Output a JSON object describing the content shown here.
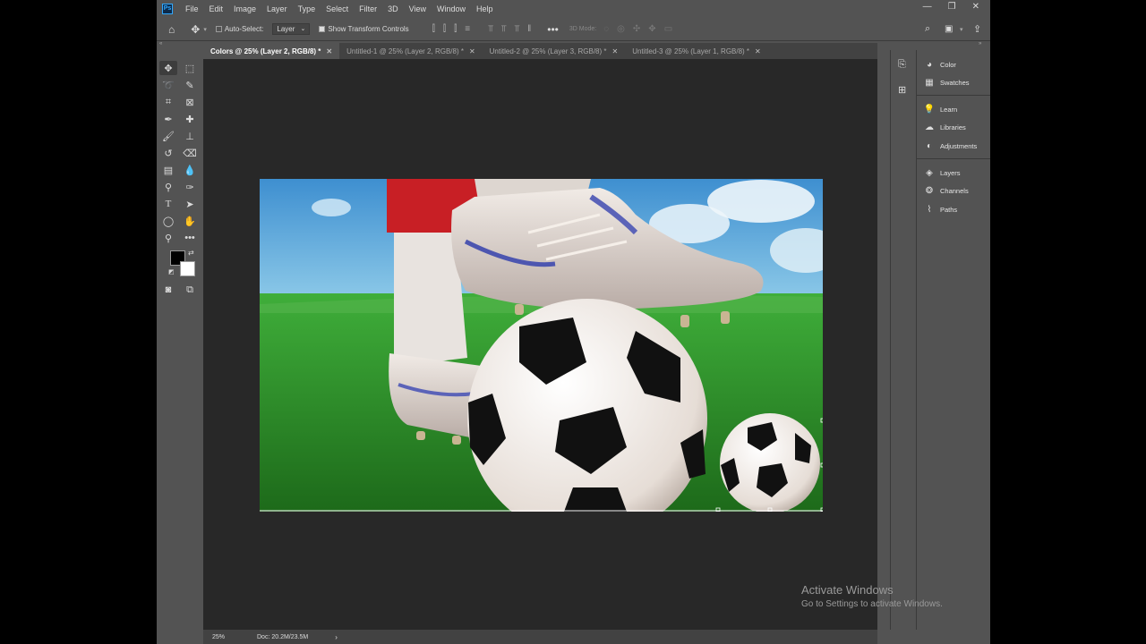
{
  "app": {
    "logo": "Ps"
  },
  "menu": [
    "File",
    "Edit",
    "Image",
    "Layer",
    "Type",
    "Select",
    "Filter",
    "3D",
    "View",
    "Window",
    "Help"
  ],
  "window_controls": {
    "minimize": "—",
    "restore": "❐",
    "close": "✕"
  },
  "options_bar": {
    "auto_select_label": "Auto-Select:",
    "auto_select_checked": false,
    "auto_select_target": "Layer",
    "show_transform_label": "Show Transform Controls",
    "show_transform_checked": true,
    "mode_3d_label": "3D Mode:"
  },
  "tabs": [
    {
      "label": "Colors @ 25% (Layer 2, RGB/8) *",
      "active": true
    },
    {
      "label": "Untitled-1 @ 25% (Layer 2, RGB/8) *",
      "active": false
    },
    {
      "label": "Untitled-2 @ 25% (Layer 3, RGB/8) *",
      "active": false
    },
    {
      "label": "Untitled-3 @ 25% (Layer 1, RGB/8) *",
      "active": false
    }
  ],
  "tools": [
    "move-tool-icon",
    "marquee-tool-icon",
    "lasso-tool-icon",
    "quick-select-tool-icon",
    "crop-tool-icon",
    "frame-tool-icon",
    "eyedropper-tool-icon",
    "healing-brush-icon",
    "brush-tool-icon",
    "clone-stamp-icon",
    "history-brush-icon",
    "eraser-tool-icon",
    "gradient-tool-icon",
    "blur-tool-icon",
    "dodge-tool-icon",
    "pen-tool-icon",
    "type-tool-icon",
    "path-select-icon",
    "ellipse-tool-icon",
    "hand-tool-icon",
    "zoom-tool-icon",
    "more-tools-icon",
    "quick-mask-icon",
    "screen-mode-icon"
  ],
  "colors": {
    "foreground": "#000000",
    "background": "#ffffff",
    "accent": "#31a8ff"
  },
  "panels": {
    "group1": [
      {
        "label": "Color",
        "icon": "color-panel-icon"
      },
      {
        "label": "Swatches",
        "icon": "swatches-icon"
      }
    ],
    "group2": [
      {
        "label": "Learn",
        "icon": "learn-icon"
      },
      {
        "label": "Libraries",
        "icon": "libraries-icon"
      },
      {
        "label": "Adjustments",
        "icon": "adjustments-icon"
      }
    ],
    "group3": [
      {
        "label": "Layers",
        "icon": "layers-icon"
      },
      {
        "label": "Channels",
        "icon": "channels-icon"
      },
      {
        "label": "Paths",
        "icon": "paths-icon"
      }
    ]
  },
  "status": {
    "zoom": "25%",
    "doc": "Doc: 20.2M/23.5M"
  },
  "activation": {
    "title": "Activate Windows",
    "subtitle": "Go to Settings to activate Windows."
  }
}
